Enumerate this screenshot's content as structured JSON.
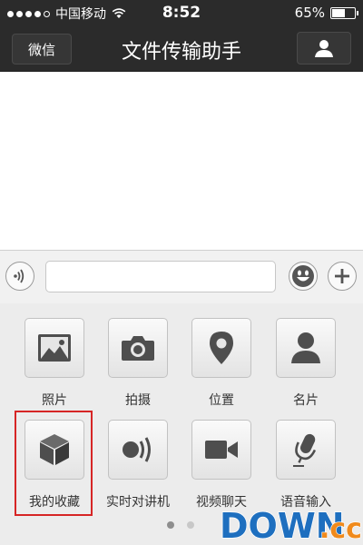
{
  "status_bar": {
    "carrier": "中国移动",
    "time": "8:52",
    "battery_percent": "65%",
    "battery_level": 0.65,
    "signal_strength": 4
  },
  "nav_bar": {
    "back_label": "微信",
    "title": "文件传输助手",
    "profile_icon": "person-icon"
  },
  "input_toolbar": {
    "voice_icon": "voice-icon",
    "text_value": "",
    "emoji_icon": "smiley-icon",
    "plus_icon": "plus-icon"
  },
  "panel": {
    "items": [
      {
        "label": "照片",
        "icon": "photo-icon"
      },
      {
        "label": "拍摄",
        "icon": "camera-icon"
      },
      {
        "label": "位置",
        "icon": "location-pin-icon"
      },
      {
        "label": "名片",
        "icon": "contact-card-icon"
      },
      {
        "label": "我的收藏",
        "icon": "favorites-cube-icon"
      },
      {
        "label": "实时对讲机",
        "icon": "walkie-talkie-icon"
      },
      {
        "label": "视频聊天",
        "icon": "video-camera-icon"
      },
      {
        "label": "语音输入",
        "icon": "microphone-icon"
      }
    ],
    "page_count": 2,
    "active_page": 1
  },
  "watermark": {
    "text_main": "DOWN",
    "text_suffix": ".cc"
  },
  "colors": {
    "bar_bg": "#2b2b2b",
    "icon_gray": "#4e4e4e",
    "highlight_red": "#d62525",
    "watermark_blue": "#1e6fbf",
    "watermark_orange": "#f08a1c"
  }
}
